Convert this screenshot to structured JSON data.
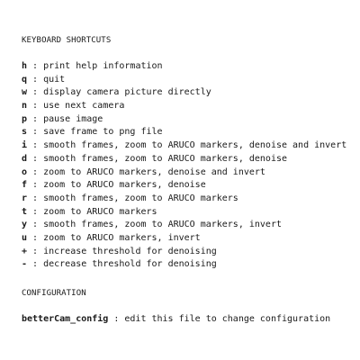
{
  "shortcuts_heading": "KEYBOARD SHORTCUTS",
  "shortcuts": [
    {
      "key": "h",
      "desc": "print help information"
    },
    {
      "key": "q",
      "desc": "quit"
    },
    {
      "key": "w",
      "desc": "display camera picture directly"
    },
    {
      "key": "n",
      "desc": "use next camera"
    },
    {
      "key": "p",
      "desc": "pause image"
    },
    {
      "key": "s",
      "desc": "save frame to png file"
    },
    {
      "key": "i",
      "desc": "smooth frames, zoom to ARUCO markers, denoise and invert"
    },
    {
      "key": "d",
      "desc": "smooth frames, zoom to ARUCO markers, denoise"
    },
    {
      "key": "o",
      "desc": "zoom to ARUCO markers, denoise and invert"
    },
    {
      "key": "f",
      "desc": "zoom to ARUCO markers, denoise"
    },
    {
      "key": "r",
      "desc": "smooth frames, zoom to ARUCO markers"
    },
    {
      "key": "t",
      "desc": "zoom to ARUCO markers"
    },
    {
      "key": "y",
      "desc": "smooth frames, zoom to ARUCO markers, invert"
    },
    {
      "key": "u",
      "desc": "zoom to ARUCO markers, invert"
    },
    {
      "key": "+",
      "desc": "increase threshold for denoising"
    },
    {
      "key": "-",
      "desc": "decrease threshold for denoising"
    }
  ],
  "separator": " : ",
  "config_heading": "CONFIGURATION",
  "config": [
    {
      "key": "betterCam_config",
      "desc": "edit this file to change configuration"
    }
  ]
}
